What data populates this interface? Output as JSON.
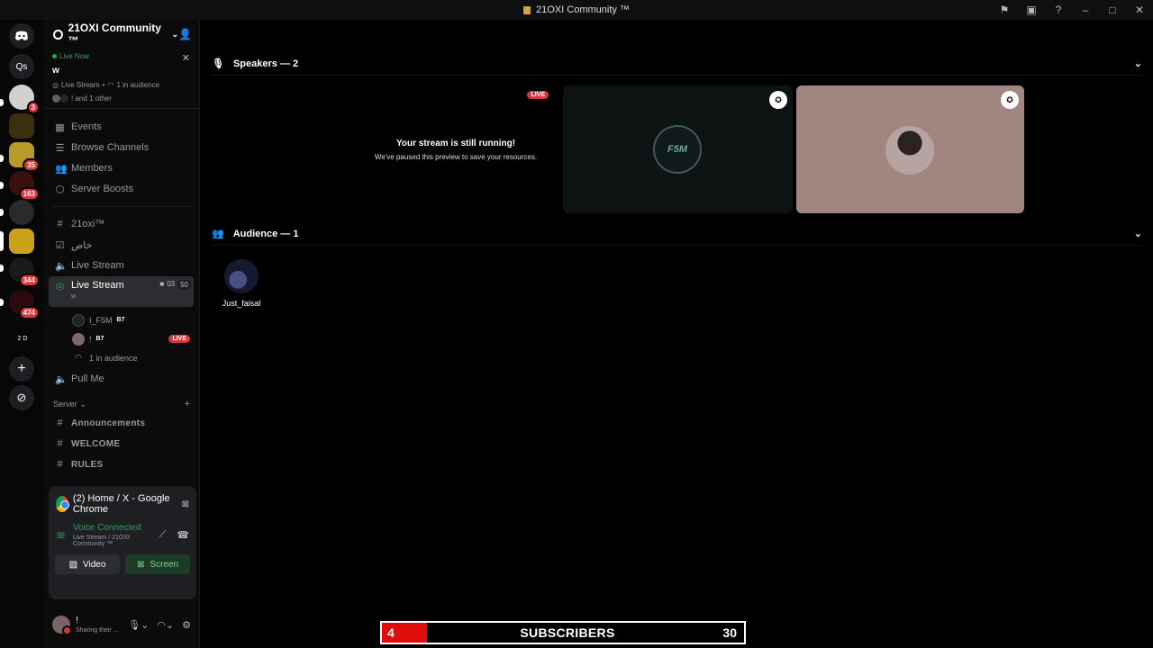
{
  "window": {
    "title": "21OXI Community ™"
  },
  "guilds": [
    {
      "label": "",
      "badge": ""
    },
    {
      "label": "Qs",
      "badge": ""
    },
    {
      "label": "",
      "badge": "3"
    },
    {
      "label": "",
      "badge": ""
    },
    {
      "label": "",
      "badge": "35"
    },
    {
      "label": "",
      "badge": "163"
    },
    {
      "label": "",
      "badge": ""
    },
    {
      "label": "",
      "badge": ""
    },
    {
      "label": "",
      "badge": "344"
    },
    {
      "label": "",
      "badge": "474"
    },
    {
      "label": "2 D",
      "badge": ""
    }
  ],
  "server": {
    "name": "21OXI Community ™"
  },
  "live": {
    "status": "Live Now",
    "title": "w",
    "channel": "Live Stream",
    "audience": "1 in audience",
    "others": "! and 1 other"
  },
  "nav": {
    "events": "Events",
    "browse": "Browse Channels",
    "members": "Members",
    "boosts": "Server Boosts"
  },
  "channels": {
    "c1": "21oxi™",
    "c2": "خاص",
    "c3": "Live Stream",
    "active": {
      "name": "Live Stream",
      "sub": "w",
      "count": "03",
      "limit": "50"
    },
    "user1": {
      "name": "I_F5M",
      "tag": "B7"
    },
    "user2": {
      "name": "!",
      "tag": "B7",
      "badge": "LIVE"
    },
    "audience": "1 in audience",
    "c4": "Pull Me",
    "category": "Server",
    "t1": "Announcements",
    "t2": "WELCOME",
    "t3": "RULES"
  },
  "panel": {
    "app": "(2) Home / X - Google Chrome",
    "status": "Voice Connected",
    "location": "Live Stream / 21OXI Community ™",
    "video": "Video",
    "screen": "Screen"
  },
  "user": {
    "name": "!",
    "status": "Sharing their ..."
  },
  "main": {
    "speakers": "Speakers — 2",
    "audience": "Audience — 1",
    "paused_title": "Your stream is still running!",
    "paused_desc": "We've paused this preview to save your resources.",
    "live_chip": "LIVE",
    "f5m_logo": "F5M",
    "audience_member": "Just_faisal"
  },
  "overlay": {
    "left": "4",
    "middle": "SUBSCRIBERS",
    "right": "30"
  },
  "colors": {
    "accent_green": "#23a55a",
    "live_red": "#da373c",
    "overlay_red": "#e00b0b"
  }
}
